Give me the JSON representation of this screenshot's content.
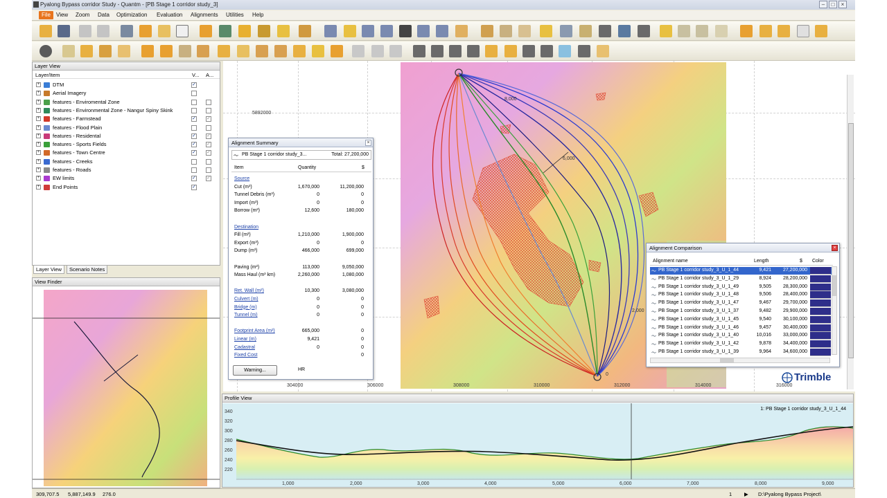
{
  "window": {
    "title": "Pyalong Bypass corridor Study - Quantm - [PB Stage 1 corridor study_3]"
  },
  "menu": [
    "File",
    "View",
    "Zoom",
    "Data",
    "Optimization",
    "Evaluation",
    "Alignments",
    "Utilities",
    "Help"
  ],
  "layer_view": {
    "title": "Layer View",
    "col_item": "Layer/Item",
    "col_v": "V...",
    "col_a": "A...",
    "layers": [
      {
        "name": "DTM",
        "color": "#3a7dd6",
        "v": true,
        "a": null
      },
      {
        "name": "Aerial Imagery",
        "color": "#c77a2a",
        "v": false,
        "a": null
      },
      {
        "name": "features - Enviromental Zone",
        "color": "#4aa04a",
        "v": false,
        "a": false
      },
      {
        "name": "features - Environmental Zone - Nangur Spiny Skink",
        "color": "#2f8a5a",
        "v": false,
        "a": false
      },
      {
        "name": "features - Farmstead",
        "color": "#d23a2a",
        "v": true,
        "a": true
      },
      {
        "name": "features - Flood Plain",
        "color": "#6a8ad0",
        "v": false,
        "a": false
      },
      {
        "name": "features - Residental",
        "color": "#c83a7a",
        "v": true,
        "a": true
      },
      {
        "name": "features - Sports Fields",
        "color": "#3aa03a",
        "v": true,
        "a": true
      },
      {
        "name": "features - Town Centre",
        "color": "#d26a2a",
        "v": true,
        "a": true
      },
      {
        "name": "features - Creeks",
        "color": "#3a6ad0",
        "v": false,
        "a": false
      },
      {
        "name": "features - Roads",
        "color": "#8a8a8a",
        "v": false,
        "a": false
      },
      {
        "name": "EW limits",
        "color": "#aa3ad0",
        "v": true,
        "a": true
      },
      {
        "name": "End Points",
        "color": "#d03a3a",
        "v": true,
        "a": null
      }
    ]
  },
  "tabs": [
    "Layer View",
    "Scenario Notes"
  ],
  "view_finder": {
    "title": "View Finder"
  },
  "map": {
    "x_labels": [
      "304000",
      "306000",
      "308000",
      "310000",
      "312000",
      "314000",
      "316000"
    ],
    "y_label": "5892000",
    "chainage": [
      "8,000",
      "6,000",
      "2,000",
      "0"
    ],
    "logo": "Trimble"
  },
  "alignment_summary": {
    "title": "Alignment Summary",
    "name": "PB Stage 1 corridor study_3...",
    "total": "Total: 27,200,000",
    "col_item": "Item",
    "col_qty": "Quantity",
    "col_cost": "$",
    "rows": [
      {
        "item": "Source",
        "link": true
      },
      {
        "item": "Cut (m³)",
        "qty": "1,670,000",
        "cost": "11,200,000"
      },
      {
        "item": "Tunnel Debris (m³)",
        "qty": "0",
        "cost": "0"
      },
      {
        "item": "Import (m³)",
        "qty": "0",
        "cost": "0"
      },
      {
        "item": "Borrow (m³)",
        "qty": "12,600",
        "cost": "180,000"
      },
      {
        "item": ""
      },
      {
        "item": "Destination",
        "link": true
      },
      {
        "item": "Fill (m³)",
        "qty": "1,210,000",
        "cost": "1,900,000"
      },
      {
        "item": "Export (m³)",
        "qty": "0",
        "cost": "0"
      },
      {
        "item": "Dump (m³)",
        "qty": "466,000",
        "cost": "699,000"
      },
      {
        "item": ""
      },
      {
        "item": "Paving (m²)",
        "qty": "113,000",
        "cost": "9,050,000"
      },
      {
        "item": "Mass Haul (m³ km)",
        "qty": "2,260,000",
        "cost": "1,080,000"
      },
      {
        "item": ""
      },
      {
        "item": "Ret. Wall (m²)",
        "qty": "10,300",
        "cost": "3,080,000",
        "link": true
      },
      {
        "item": "Culvert (m)",
        "qty": "0",
        "cost": "0",
        "link": true
      },
      {
        "item": "Bridge (m)",
        "qty": "0",
        "cost": "0",
        "link": true
      },
      {
        "item": "Tunnel (m)",
        "qty": "0",
        "cost": "0",
        "link": true
      },
      {
        "item": ""
      },
      {
        "item": "Footprint Area (m²)",
        "qty": "665,000",
        "cost": "0",
        "link": true
      },
      {
        "item": "Linear (m)",
        "qty": "9,421",
        "cost": "0",
        "link": true
      },
      {
        "item": "Cadastral",
        "qty": "0",
        "cost": "0",
        "link": true
      },
      {
        "item": "Fixed Cost",
        "qty": "",
        "cost": "0",
        "link": true
      }
    ],
    "warning_btn": "Warning...",
    "hr": "HR"
  },
  "alignment_comparison": {
    "title": "Alignment Comparison",
    "col_name": "Alignment name",
    "col_len": "Length",
    "col_cost": "$",
    "col_color": "Color",
    "rows": [
      {
        "name": "PB Stage 1 corridor study_3_U_1_44",
        "len": "9,421",
        "cost": "27,200,000",
        "sel": true
      },
      {
        "name": "PB Stage 1 corridor study_3_U_1_29",
        "len": "8,924",
        "cost": "28,200,000"
      },
      {
        "name": "PB Stage 1 corridor study_3_U_1_49",
        "len": "9,505",
        "cost": "28,300,000"
      },
      {
        "name": "PB Stage 1 corridor study_3_U_1_48",
        "len": "9,506",
        "cost": "28,400,000"
      },
      {
        "name": "PB Stage 1 corridor study_3_U_1_47",
        "len": "9,467",
        "cost": "29,700,000"
      },
      {
        "name": "PB Stage 1 corridor study_3_U_1_37",
        "len": "9,482",
        "cost": "29,900,000"
      },
      {
        "name": "PB Stage 1 corridor study_3_U_1_45",
        "len": "9,540",
        "cost": "30,100,000"
      },
      {
        "name": "PB Stage 1 corridor study_3_U_1_46",
        "len": "9,457",
        "cost": "30,400,000"
      },
      {
        "name": "PB Stage 1 corridor study_3_U_1_40",
        "len": "10,016",
        "cost": "33,000,000"
      },
      {
        "name": "PB Stage 1 corridor study_3_U_1_42",
        "len": "9,878",
        "cost": "34,400,000"
      },
      {
        "name": "PB Stage 1 corridor study_3_U_1_39",
        "len": "9,964",
        "cost": "34,600,000"
      }
    ]
  },
  "profile": {
    "title": "Profile View",
    "label": "1: PB Stage 1 corridor study_3_U_1_44",
    "y_ticks": [
      "340",
      "320",
      "300",
      "280",
      "260",
      "240",
      "220"
    ],
    "x_ticks": [
      "1,000",
      "2,000",
      "3,000",
      "4,000",
      "5,000",
      "6,000",
      "7,000",
      "8,000",
      "9,000"
    ]
  },
  "status": {
    "x": "309,707.5",
    "y": "5,887,149.9",
    "z": "276.0",
    "page": "1",
    "path": "D:\\Pyalong Bypass Project\\"
  },
  "colors": {
    "accent": "#e8741c",
    "selected_row": "#3366cc",
    "profile_bg": "#d8eef4"
  }
}
